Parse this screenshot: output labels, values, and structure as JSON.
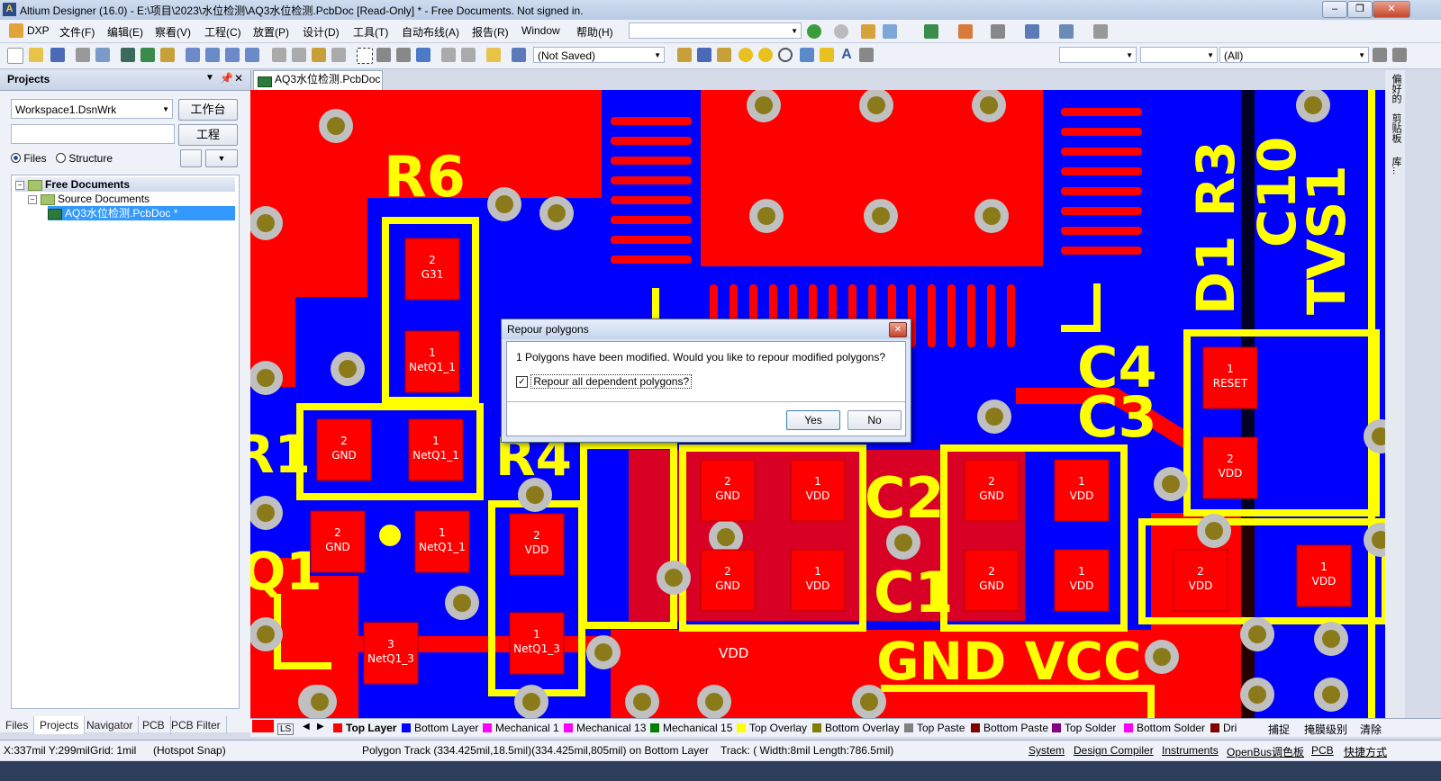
{
  "window": {
    "title": "Altium Designer (16.0) - E:\\项目\\2023\\水位检测\\AQ3水位检测.PcbDoc [Read-Only] * - Free Documents. Not signed in.",
    "app_icon": "A"
  },
  "menu": [
    "DXP",
    "文件(F)",
    "编辑(E)",
    "察看(V)",
    "工程(C)",
    "放置(P)",
    "设计(D)",
    "工具(T)",
    "自动布线(A)",
    "报告(R)",
    "Window",
    "帮助(H)"
  ],
  "toolbar": {
    "saved_state": "(Not Saved)",
    "filter_all": "(All)"
  },
  "projects_panel": {
    "title": "Projects",
    "workspace": "Workspace1.DsnWrk",
    "workspace_button": "工作台",
    "project_button": "工程",
    "radio_files": "Files",
    "radio_structure": "Structure",
    "tree": {
      "root": "Free Documents",
      "folder": "Source Documents",
      "file": "AQ3水位检测.PcbDoc *"
    },
    "bottom_tabs": [
      "Files",
      "Projects",
      "Navigator",
      "PCB",
      "PCB Filter"
    ]
  },
  "document_tab": "AQ3水位检测.PcbDoc *",
  "right_panel_tabs": [
    "偏好的",
    "剪贴板",
    "库..."
  ],
  "pcb": {
    "designators": [
      "R6",
      "R4",
      "C2",
      "C1",
      "C4",
      "C3",
      "D1 R3",
      "C10",
      "TVS1",
      "R1",
      "Q1",
      "GND VCC"
    ],
    "pads": [
      {
        "num": "2",
        "net": "G31"
      },
      {
        "num": "1",
        "net": "NetQ1_1"
      },
      {
        "num": "2",
        "net": "GND"
      },
      {
        "num": "1",
        "net": "NetQ1_1"
      },
      {
        "num": "2",
        "net": "GND"
      },
      {
        "num": "1",
        "net": "NetQ1_1"
      },
      {
        "num": "2",
        "net": "VDD"
      },
      {
        "num": "1",
        "net": "NetQ1_3"
      },
      {
        "num": "3",
        "net": "NetQ1_3"
      },
      {
        "num": "2",
        "net": "GND"
      },
      {
        "num": "1",
        "net": "VDD"
      },
      {
        "num": "2",
        "net": "GND"
      },
      {
        "num": "1",
        "net": "VDD"
      },
      {
        "num": "2",
        "net": "GND"
      },
      {
        "num": "1",
        "net": "VDD"
      },
      {
        "num": "2",
        "net": "GND"
      },
      {
        "num": "1",
        "net": "VDD"
      },
      {
        "num": "1",
        "net": "RESET"
      },
      {
        "num": "2",
        "net": "VDD"
      },
      {
        "num": "2",
        "net": "VDD"
      },
      {
        "num": "1",
        "net": "VDD"
      }
    ],
    "track_label": "VDD"
  },
  "layers": [
    {
      "name": "LS",
      "color": "#ff0000"
    },
    {
      "name": "Top Layer",
      "color": "#ff0000"
    },
    {
      "name": "Bottom Layer",
      "color": "#0000ff"
    },
    {
      "name": "Mechanical 1",
      "color": "#ff00ff"
    },
    {
      "name": "Mechanical 13",
      "color": "#ff00ff"
    },
    {
      "name": "Mechanical 15",
      "color": "#008000"
    },
    {
      "name": "Top Overlay",
      "color": "#ffff00"
    },
    {
      "name": "Bottom Overlay",
      "color": "#808000"
    },
    {
      "name": "Top Paste",
      "color": "#808080"
    },
    {
      "name": "Bottom Paste",
      "color": "#800000"
    },
    {
      "name": "Top Solder",
      "color": "#800080"
    },
    {
      "name": "Bottom Solder",
      "color": "#ff00ff"
    },
    {
      "name": "Dri",
      "color": "#800000"
    }
  ],
  "layer_bar_right": [
    "捕捉",
    "掩膜级别",
    "清除"
  ],
  "status": {
    "coords": "X:337mil Y:299mil",
    "grid": "Grid: 1mil",
    "snap": "(Hotspot Snap)",
    "object": "Polygon Track (334.425mil,18.5mil)(334.425mil,805mil) on Bottom Layer",
    "track": "Track: ( Width:8mil Length:786.5mil)",
    "right_tabs": [
      "System",
      "Design Compiler",
      "Instruments",
      "OpenBus调色板",
      "PCB",
      "快捷方式"
    ]
  },
  "dialog": {
    "title": "Repour polygons",
    "message": "1 Polygons have been modified. Would you like to repour modified polygons?",
    "checkbox_label": "Repour all dependent polygons?",
    "checkbox_checked": true,
    "yes": "Yes",
    "no": "No"
  },
  "colors": {
    "top_copper": "#ff0000",
    "bottom_copper": "#0000ff",
    "overlay": "#ffff00",
    "via": "#c0c0c0"
  }
}
